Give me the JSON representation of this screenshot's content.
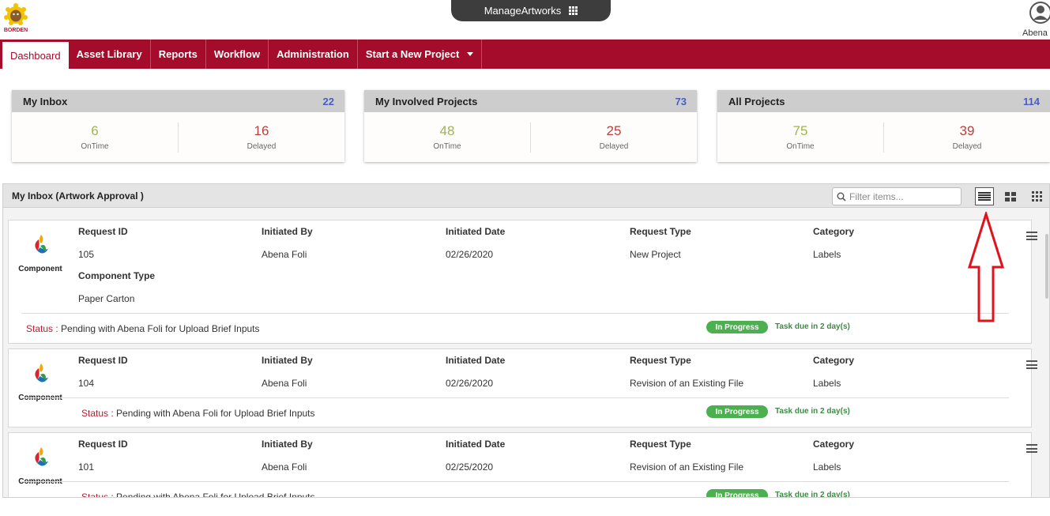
{
  "header": {
    "app_name": "ManageArtworks",
    "user_name": "Abena"
  },
  "nav": {
    "items": [
      {
        "label": "Dashboard"
      },
      {
        "label": "Asset Library"
      },
      {
        "label": "Reports"
      },
      {
        "label": "Workflow"
      },
      {
        "label": "Administration"
      },
      {
        "label": "Start a New Project"
      }
    ]
  },
  "summary": [
    {
      "title": "My Inbox",
      "count": "22",
      "ontime": "6",
      "delayed": "16"
    },
    {
      "title": "My Involved Projects",
      "count": "73",
      "ontime": "48",
      "delayed": "25"
    },
    {
      "title": "All Projects",
      "count": "114",
      "ontime": "75",
      "delayed": "39"
    }
  ],
  "labels": {
    "ontime": "OnTime",
    "delayed": "Delayed",
    "request_id": "Request ID",
    "initiated_by": "Initiated By",
    "initiated_date": "Initiated Date",
    "request_type": "Request Type",
    "category": "Category",
    "component_type": "Component Type",
    "status": "Status :",
    "component": "Component"
  },
  "inbox": {
    "title": "My Inbox (Artwork Approval )",
    "filter_placeholder": "Filter items...",
    "items": [
      {
        "request_id": "105",
        "initiated_by": "Abena Foli",
        "initiated_date": "02/26/2020",
        "request_type": "New Project",
        "category": "Labels",
        "component_type": "Paper Carton",
        "status": "Pending with Abena Foli for Upload Brief Inputs",
        "badge": "In Progress",
        "due": "Task due in 2 day(s)"
      },
      {
        "request_id": "104",
        "initiated_by": "Abena Foli",
        "initiated_date": "02/26/2020",
        "request_type": "Revision of an Existing File",
        "category": "Labels",
        "status": "Pending with Abena Foli for Upload Brief Inputs",
        "badge": "In Progress",
        "due": "Task due in 2 day(s)"
      },
      {
        "request_id": "101",
        "initiated_by": "Abena Foli",
        "initiated_date": "02/25/2020",
        "request_type": "Revision of an Existing File",
        "category": "Labels",
        "status": "Pending with Abena Foli for Upload Brief Inputs",
        "badge": "In Progress",
        "due": "Task due in 2 day(s)"
      }
    ]
  },
  "colors": {
    "brand": "#a50b2b",
    "ontime": "#9ab553",
    "delayed": "#b84040",
    "count": "#4a5cc4",
    "badge": "#4caf50",
    "annotation": "#e0121b"
  },
  "icons": {
    "logo": "borden-logo",
    "user": "user-avatar-icon",
    "apps": "apps-grid-icon",
    "search": "search-icon",
    "list_view": "list-view-icon",
    "card_view": "card-view-icon",
    "grid_view": "grid-view-icon",
    "row_menu": "hamburger-menu-icon",
    "annotation": "red-up-arrow-annotation"
  }
}
